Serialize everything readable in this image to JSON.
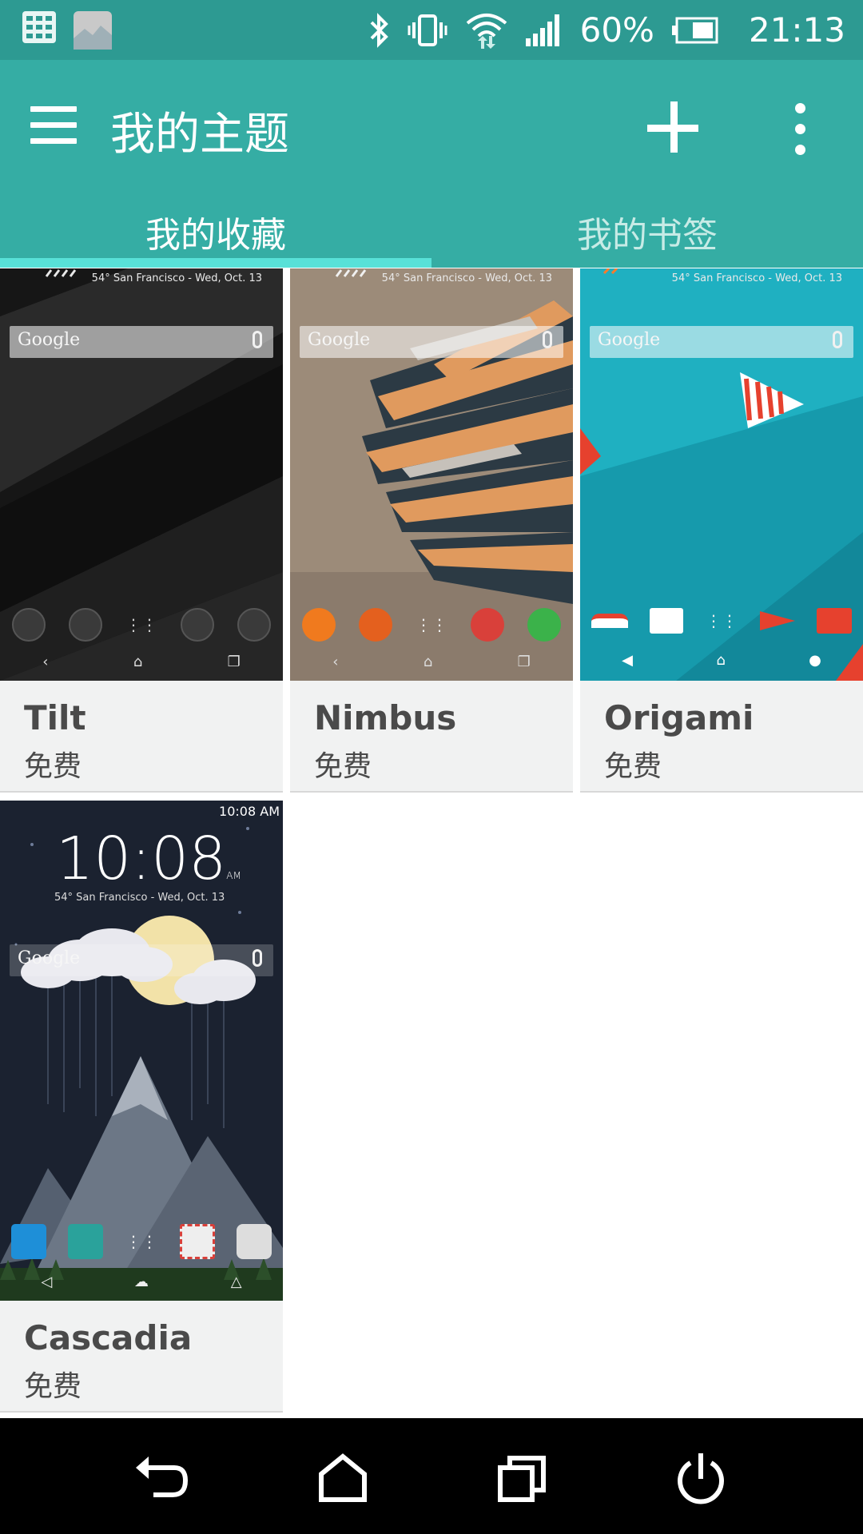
{
  "status_bar": {
    "battery_percent": "60%",
    "time": "21:13",
    "icons": [
      "keyboard-grid-icon",
      "gallery-icon",
      "bluetooth-icon",
      "vibrate-icon",
      "wifi-icon",
      "signal-icon",
      "battery-icon"
    ]
  },
  "app_bar": {
    "title": "我的主题",
    "tabs": [
      {
        "label": "我的收藏",
        "selected": true
      },
      {
        "label": "我的书签",
        "selected": false
      }
    ],
    "accent_color": "#35ada4"
  },
  "preview_text": {
    "weather": "54° San Francisco - Wed, Oct. 13",
    "search_label": "Google",
    "clock": "10:08",
    "clock_ampm": "AM",
    "status_time": "10:08 AM"
  },
  "themes": [
    {
      "name": "Tilt",
      "price": "免费"
    },
    {
      "name": "Nimbus",
      "price": "免费"
    },
    {
      "name": "Origami",
      "price": "免费"
    },
    {
      "name": "Cascadia",
      "price": "免费"
    }
  ],
  "system_nav": [
    "back-icon",
    "home-icon",
    "recents-icon",
    "power-icon"
  ]
}
